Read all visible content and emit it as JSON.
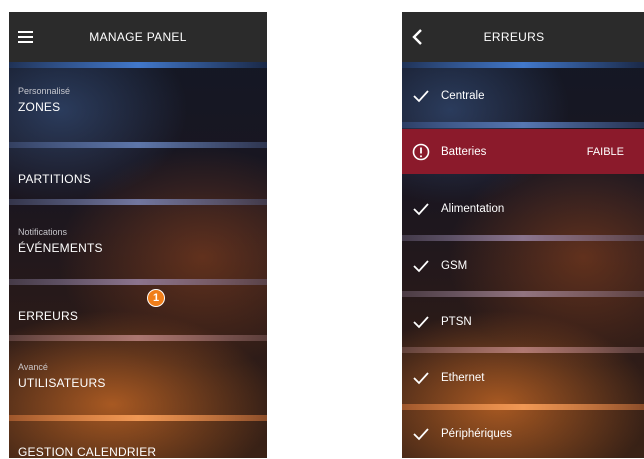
{
  "left_screen": {
    "header": {
      "title": "MANAGE PANEL",
      "menu_icon": "hamburger-menu-icon"
    },
    "items": [
      {
        "section": "Personnalisé",
        "label": "ZONES"
      },
      {
        "section": "",
        "label": "PARTITIONS"
      },
      {
        "section": "Notifications",
        "label": "ÉVÉNEMENTS"
      },
      {
        "section": "",
        "label": "ERREURS"
      },
      {
        "section": "Avancé",
        "label": "UTILISATEURS"
      },
      {
        "section": "",
        "label": "GESTION CALENDRIER"
      }
    ],
    "callout_badge": "1"
  },
  "right_screen": {
    "header": {
      "title": "ERREURS",
      "back_icon": "chevron-left-icon"
    },
    "items": [
      {
        "label": "Centrale",
        "status": "",
        "icon": "check-icon"
      },
      {
        "label": "Batteries",
        "status": "FAIBLE",
        "icon": "alert-circle-icon"
      },
      {
        "label": "Alimentation",
        "status": "",
        "icon": "check-icon"
      },
      {
        "label": "GSM",
        "status": "",
        "icon": "check-icon"
      },
      {
        "label": "PTSN",
        "status": "",
        "icon": "check-icon"
      },
      {
        "label": "Ethernet",
        "status": "",
        "icon": "check-icon"
      },
      {
        "label": "Périphériques",
        "status": "",
        "icon": "check-icon"
      }
    ],
    "error_color": "#8b1a2b"
  },
  "colors": {
    "header_bg": "#2b2b2b",
    "badge": "#f07e1a"
  }
}
